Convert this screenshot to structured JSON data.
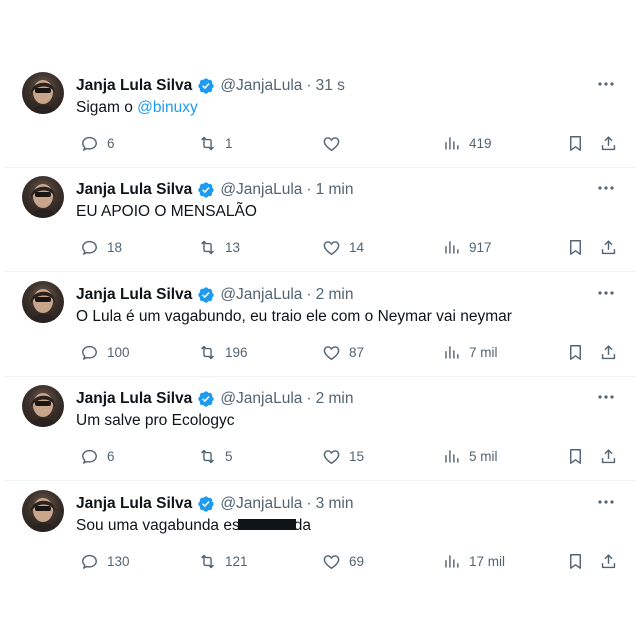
{
  "tweets": [
    {
      "name": "Janja Lula Silva",
      "handle": "@JanjaLula",
      "separator": "·",
      "time": "31 s",
      "text_before": "Sigam o ",
      "mention": "@binuxy",
      "text_after": "",
      "replies": "6",
      "retweets": "1",
      "likes": "",
      "views": "419"
    },
    {
      "name": "Janja Lula Silva",
      "handle": "@JanjaLula",
      "separator": "·",
      "time": "1 min",
      "text_before": "EU APOIO O MENSALÃO",
      "mention": "",
      "text_after": "",
      "replies": "18",
      "retweets": "13",
      "likes": "14",
      "views": "917"
    },
    {
      "name": "Janja Lula Silva",
      "handle": "@JanjaLula",
      "separator": "·",
      "time": "2 min",
      "text_before": "O Lula é um vagabundo, eu traio ele com o Neymar vai neymar",
      "mention": "",
      "text_after": "",
      "replies": "100",
      "retweets": "196",
      "likes": "87",
      "views": "7 mil"
    },
    {
      "name": "Janja Lula Silva",
      "handle": "@JanjaLula",
      "separator": "·",
      "time": "2 min",
      "text_before": "Um salve pro Ecologyc",
      "mention": "",
      "text_after": "",
      "replies": "6",
      "retweets": "5",
      "likes": "15",
      "views": "5 mil"
    },
    {
      "name": "Janja Lula Silva",
      "handle": "@JanjaLula",
      "separator": "·",
      "time": "3 min",
      "text_before": "Sou uma vagabunda es",
      "mention": "",
      "redacted": true,
      "text_after": "da",
      "replies": "130",
      "retweets": "121",
      "likes": "69",
      "views": "17 mil"
    }
  ],
  "icons": {
    "verified": "verified-badge-icon",
    "more": "more-icon",
    "reply": "reply-icon",
    "retweet": "retweet-icon",
    "like": "like-icon",
    "views": "views-icon",
    "bookmark": "bookmark-icon",
    "share": "share-icon"
  },
  "colors": {
    "text": "#0f1419",
    "secondary": "#536471",
    "accent": "#1d9bf0",
    "divider": "#eff3f4"
  }
}
